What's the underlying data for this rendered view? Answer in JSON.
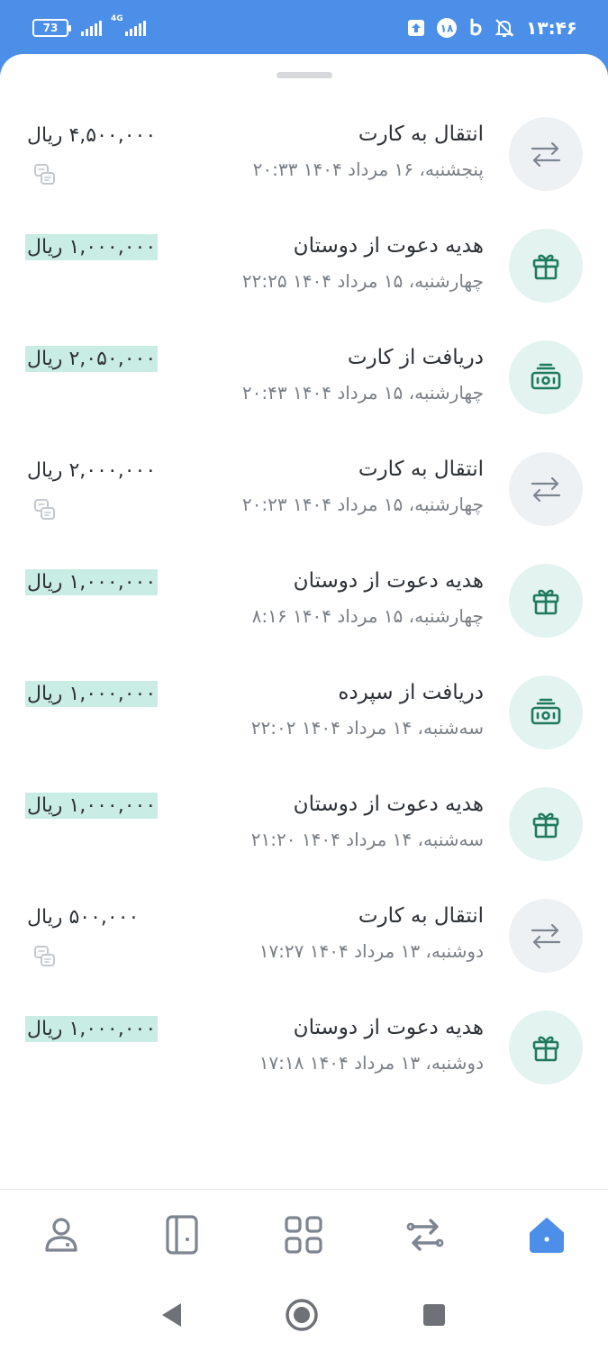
{
  "status_bar": {
    "battery": "73",
    "network": "4G",
    "notification_count": "۱۸",
    "time": "۱۳:۴۶"
  },
  "transactions": [
    {
      "title": "انتقال به کارت",
      "date": "پنجشنبه، ۱۶ مرداد ۱۴۰۴ ۲۰:۳۳",
      "amount": "۴,۵۰۰,۰۰۰ ریال",
      "type": "transfer"
    },
    {
      "title": "هدیه دعوت از دوستان",
      "date": "چهارشنبه، ۱۵ مرداد ۱۴۰۴ ۲۲:۲۵",
      "amount": "۱,۰۰۰,۰۰۰ ریال",
      "type": "gift"
    },
    {
      "title": "دریافت از کارت",
      "date": "چهارشنبه، ۱۵ مرداد ۱۴۰۴ ۲۰:۴۳",
      "amount": "۲,۰۵۰,۰۰۰ ریال",
      "type": "receive"
    },
    {
      "title": "انتقال به کارت",
      "date": "چهارشنبه، ۱۵ مرداد ۱۴۰۴ ۲۰:۲۳",
      "amount": "۲,۰۰۰,۰۰۰ ریال",
      "type": "transfer"
    },
    {
      "title": "هدیه دعوت از دوستان",
      "date": "چهارشنبه، ۱۵ مرداد ۱۴۰۴ ۸:۱۶",
      "amount": "۱,۰۰۰,۰۰۰ ریال",
      "type": "gift"
    },
    {
      "title": "دریافت از سپرده",
      "date": "سه‌شنبه، ۱۴ مرداد ۱۴۰۴ ۲۲:۰۲",
      "amount": "۱,۰۰۰,۰۰۰ ریال",
      "type": "receive"
    },
    {
      "title": "هدیه دعوت از دوستان",
      "date": "سه‌شنبه، ۱۴ مرداد ۱۴۰۴ ۲۱:۲۰",
      "amount": "۱,۰۰۰,۰۰۰ ریال",
      "type": "gift"
    },
    {
      "title": "انتقال به کارت",
      "date": "دوشنبه، ۱۳ مرداد ۱۴۰۴ ۱۷:۲۷",
      "amount": "۵۰۰,۰۰۰ ریال",
      "type": "transfer"
    },
    {
      "title": "هدیه دعوت از دوستان",
      "date": "دوشنبه، ۱۳ مرداد ۱۴۰۴ ۱۷:۱۸",
      "amount": "۱,۰۰۰,۰۰۰ ریال",
      "type": "gift"
    }
  ],
  "bottom_nav": {
    "items": [
      "home-icon",
      "transfer-icon",
      "apps-grid-icon",
      "card-icon",
      "profile-icon"
    ],
    "active": "home-icon"
  },
  "colors": {
    "accent": "#4c8fe8",
    "credit_highlight": "#c9ece5",
    "green_icon": "#1f7a5e",
    "gray_icon": "#7d8591"
  }
}
